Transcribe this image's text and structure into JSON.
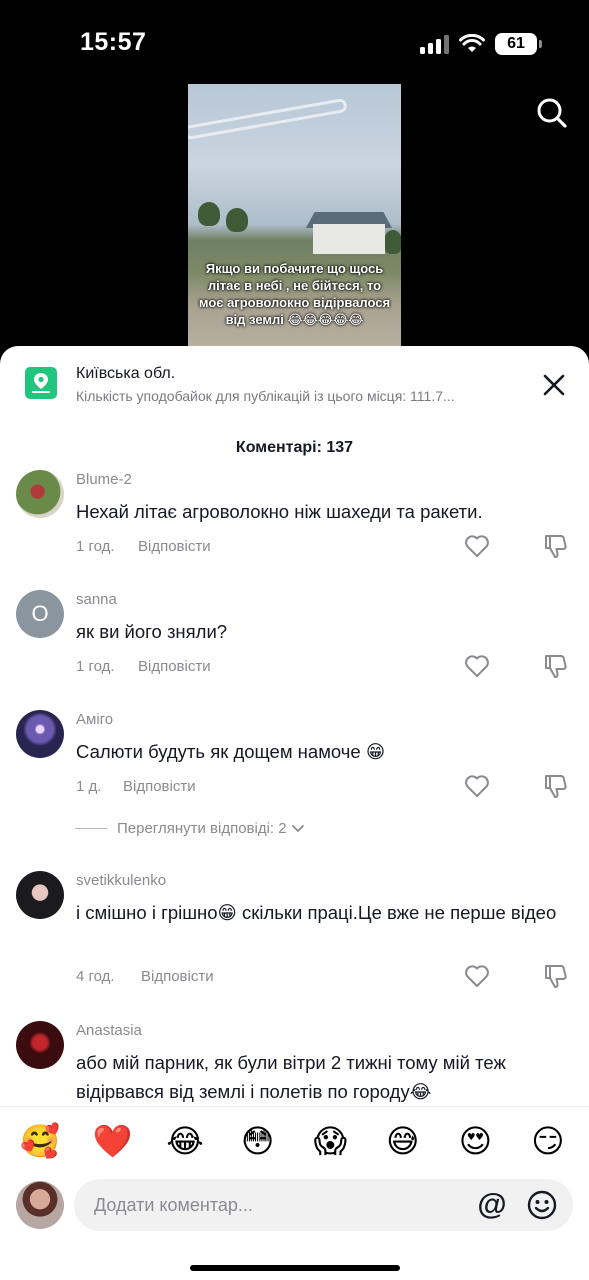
{
  "status_bar": {
    "time": "15:57",
    "battery": "61"
  },
  "video": {
    "caption": "Якщо ви побачите що щось літає в небі , не бійтеся,  то моє агроволокно відірвалося від землі 😂😂😂😂😂"
  },
  "location": {
    "title": "Київська обл.",
    "subtitle": "Кількість уподобайок для публікацій із цього місця: 111.7..."
  },
  "comments_header": "Коментарі: 137",
  "reply_label": "Відповісти",
  "comments": [
    {
      "user": "Blume-2",
      "text": "Нехай літає агроволокно ніж шахеди та ракети.",
      "time": "1 год."
    },
    {
      "user": "sanna",
      "avatar_letter": "O",
      "text": "як ви його зняли?",
      "time": "1 год."
    },
    {
      "user": "Аміго",
      "text": "Салюти будуть як дощем намоче 😁",
      "time": "1 д."
    },
    {
      "user": "svetikkulenko",
      "text": "і смішно і грішно😁 скільки праці.Це вже не перше відео",
      "time": "4 год."
    },
    {
      "user": "Anastasia",
      "text": "або мій парник, як були вітри 2 тижні тому мій теж відірвався від землі і полетів по городу😂",
      "time": ""
    }
  ],
  "view_replies": "Переглянути відповіді: 2",
  "emoji_bar": [
    "🥰",
    "❤️",
    "😂",
    "😳",
    "😱",
    "😅",
    "😍",
    "😏"
  ],
  "input": {
    "placeholder": "Додати коментар...",
    "value": ""
  },
  "icons": {
    "search": "search-icon",
    "close": "close-icon",
    "location": "location-pin-icon",
    "like": "heart-outline-icon",
    "dislike": "thumbs-down-icon",
    "mention": "at-icon",
    "emoji": "smiley-icon"
  },
  "colors": {
    "accent_green": "#20c67d",
    "text_primary": "#161823",
    "text_secondary": "#8a8b91"
  }
}
